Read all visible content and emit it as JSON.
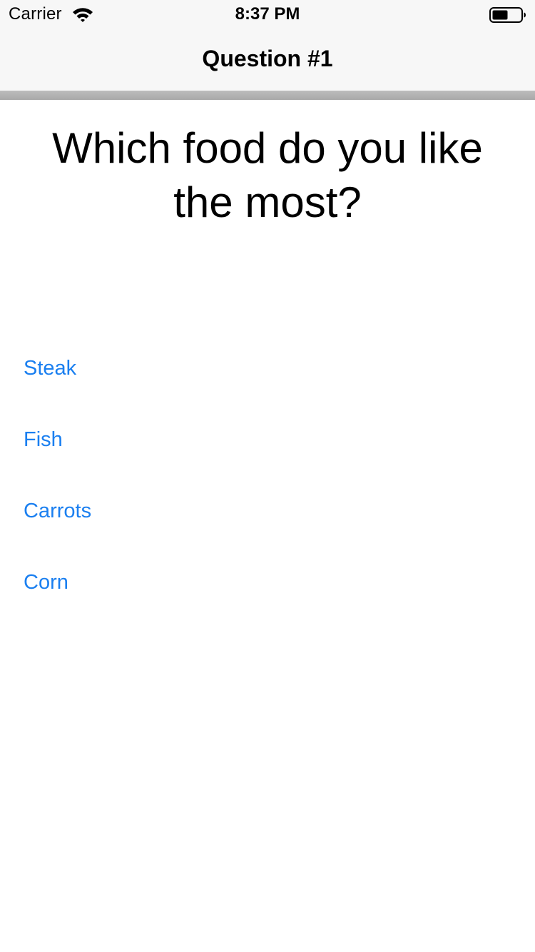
{
  "status_bar": {
    "carrier": "Carrier",
    "time": "8:37 PM",
    "wifi_icon": "wifi-icon",
    "battery_icon": "battery-icon"
  },
  "nav": {
    "title": "Question #1"
  },
  "question": {
    "text": "Which food do you like the most?"
  },
  "answers": [
    {
      "label": "Steak"
    },
    {
      "label": "Fish"
    },
    {
      "label": "Carrots"
    },
    {
      "label": "Corn"
    }
  ],
  "colors": {
    "accent": "#1a7ff0",
    "nav_background": "#f7f7f7",
    "text": "#000000"
  }
}
